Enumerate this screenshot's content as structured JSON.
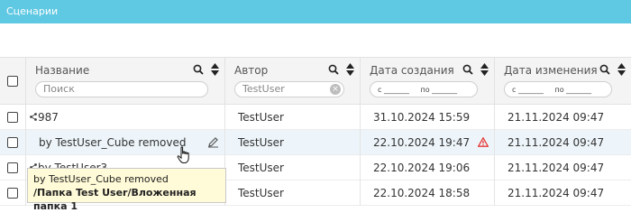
{
  "window": {
    "title": "Сценарии"
  },
  "columns": {
    "name": {
      "label": "Название",
      "filter_placeholder": "Поиск"
    },
    "author": {
      "label": "Автор",
      "filter_value": "TestUser"
    },
    "created": {
      "label": "Дата создания",
      "filter_from": "с _______",
      "filter_to": "по _______"
    },
    "modified": {
      "label": "Дата изменения",
      "filter_from": "с _______",
      "filter_to": "по _______"
    }
  },
  "rows": [
    {
      "name": "987",
      "shared": true,
      "author": "TestUser",
      "created": "31.10.2024 15:59",
      "modified": "21.11.2024 09:47"
    },
    {
      "name": "by TestUser_Cube removed",
      "shared": false,
      "author": "TestUser",
      "created": "22.10.2024 19:47",
      "modified": "21.11.2024 09:47",
      "warning": true
    },
    {
      "name": "by TestUser3",
      "shared": true,
      "author": "TestUser",
      "created": "22.10.2024 19:06",
      "modified": "21.11.2024 09:47"
    },
    {
      "name": "",
      "shared": false,
      "author": "TestUser",
      "created": "22.10.2024 18:58",
      "modified": "21.11.2024 09:47"
    }
  ],
  "tooltip": {
    "line1": "by TestUser_Cube removed",
    "line2": "/Папка Test User/Вложенная папка 1"
  },
  "colors": {
    "titlebar": "#5fc8e2",
    "warning": "#e53935",
    "active_row": "#edf5fa"
  }
}
